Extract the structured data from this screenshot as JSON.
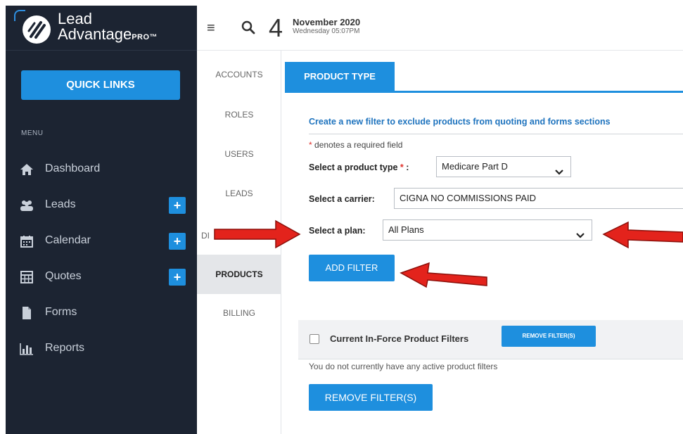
{
  "brand": {
    "line1": "Lead",
    "line2": "Advantage",
    "pro": "PRO™"
  },
  "sidebar": {
    "quick_links": "QUICK LINKS",
    "menu_label": "MENU",
    "items": [
      {
        "label": "Dashboard",
        "icon": "home-icon",
        "has_plus": false
      },
      {
        "label": "Leads",
        "icon": "users-icon",
        "has_plus": true
      },
      {
        "label": "Calendar",
        "icon": "calendar-icon",
        "has_plus": true
      },
      {
        "label": "Quotes",
        "icon": "calculator-icon",
        "has_plus": true
      },
      {
        "label": "Forms",
        "icon": "document-icon",
        "has_plus": false
      },
      {
        "label": "Reports",
        "icon": "bar-chart-icon",
        "has_plus": false
      }
    ],
    "plus_label": "+"
  },
  "header": {
    "menu_icon": "≡",
    "day": "4",
    "month_year": "November 2020",
    "weekday_time": "Wednesday 05:07PM"
  },
  "subnav": {
    "items": [
      "ACCOUNTS",
      "ROLES",
      "USERS",
      "LEADS",
      "DI",
      "PRODUCTS",
      "BILLING"
    ],
    "active": "PRODUCTS"
  },
  "main": {
    "tab": "PRODUCT TYPE",
    "intro": "Create a new filter to exclude products from quoting and forms sections",
    "required_star": "*",
    "required_note": "denotes a required field",
    "product_type_label": "Select a product type",
    "product_type_suffix": ":",
    "product_type_value": "Medicare Part D",
    "carrier_label": "Select a carrier:",
    "carrier_value": "CIGNA NO COMMISSIONS PAID",
    "plan_label": "Select a plan:",
    "plan_value": "All Plans",
    "add_filter": "ADD FILTER",
    "filters_title": "Current In-Force Product Filters",
    "remove_small": "REMOVE FILTER(S)",
    "no_filters": "You do not currently have any active product filters",
    "remove_big": "REMOVE FILTER(S)"
  },
  "colors": {
    "sidebar_bg": "#1c2432",
    "accent": "#1e8fde",
    "annotation_red": "#e3231c"
  }
}
